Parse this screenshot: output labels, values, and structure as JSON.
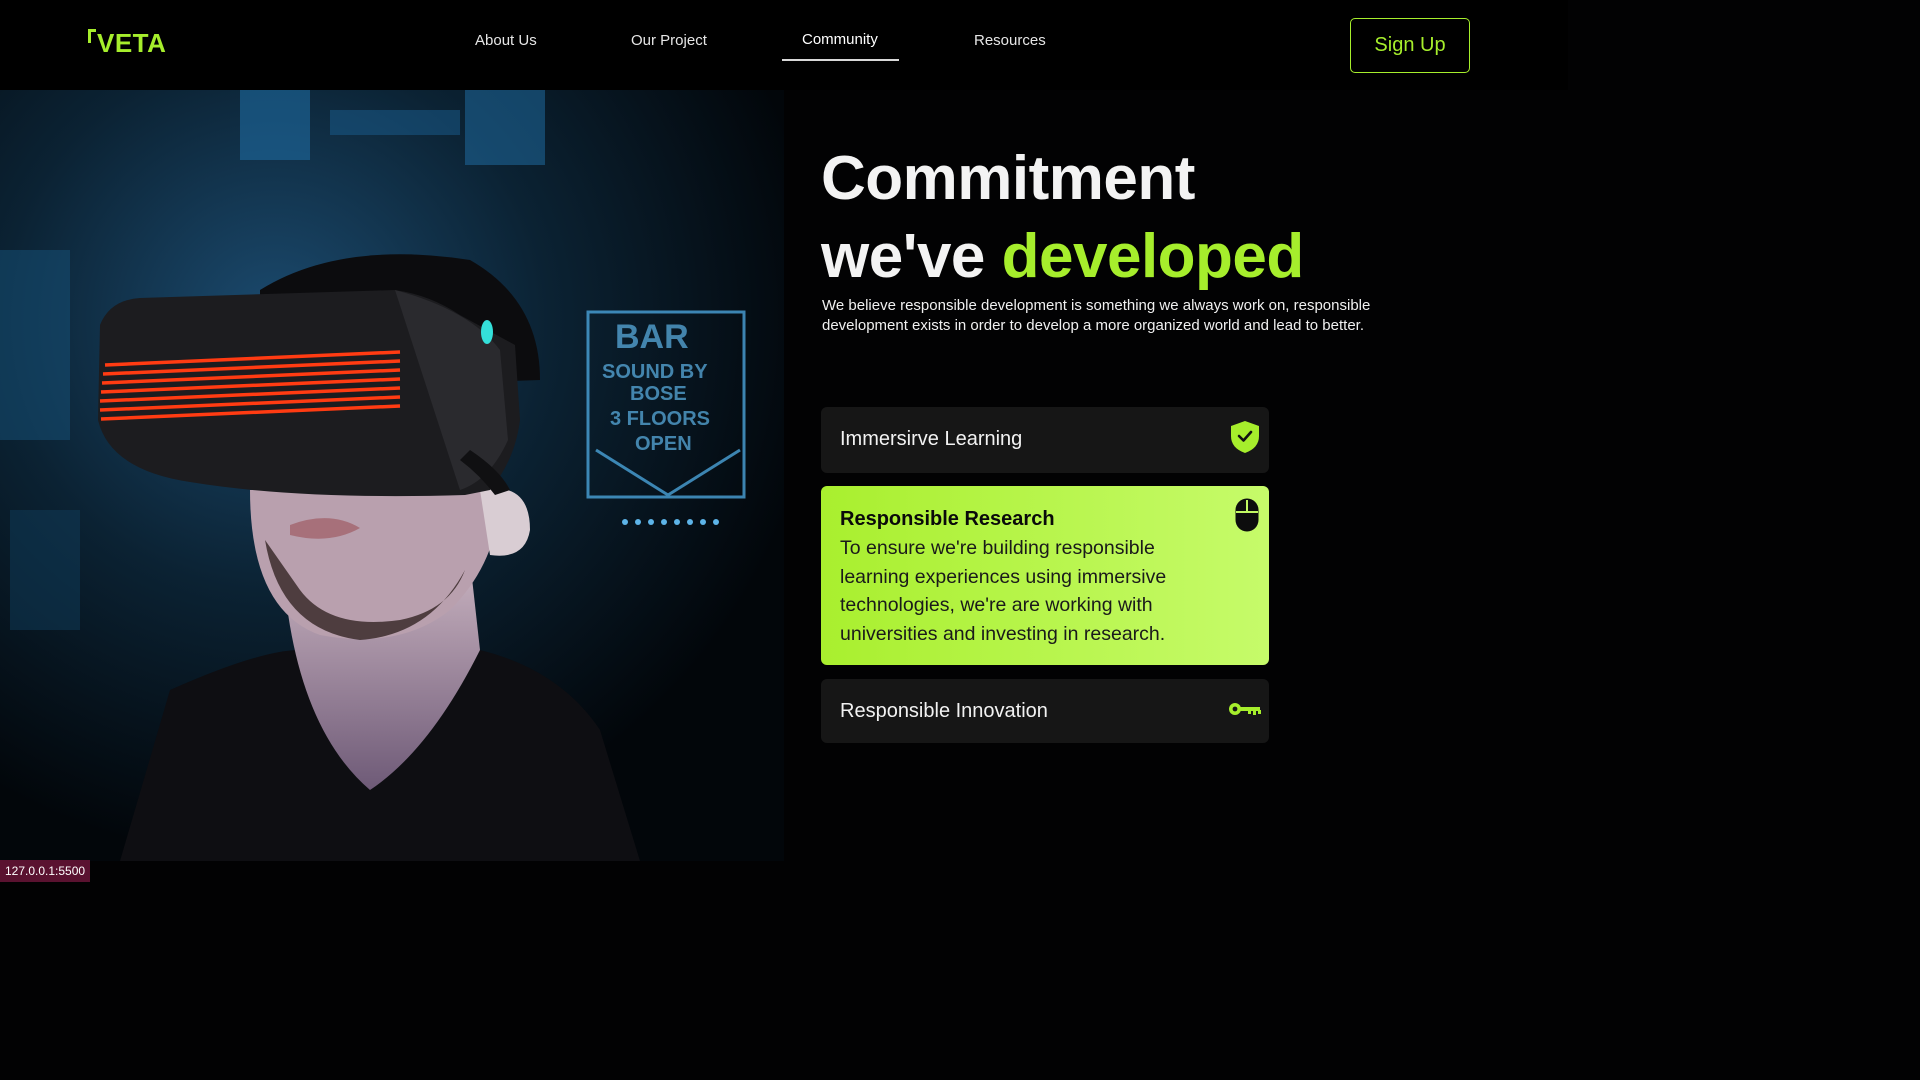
{
  "brand": {
    "name": "VETA",
    "accent": "#a6ee2c"
  },
  "nav": {
    "links": [
      {
        "label": "About Us"
      },
      {
        "label": "Our Project"
      },
      {
        "label": "Community",
        "active": true
      },
      {
        "label": "Resources"
      }
    ],
    "signup_label": "Sign Up"
  },
  "hero": {
    "image_icon": "vr-headset-person-photo"
  },
  "headline": {
    "line1": "Commitment",
    "line2_plain": "we've ",
    "line2_accent": "developed"
  },
  "subtext": "We believe responsible development is something we always work on, responsible development exists in order to develop a more organized world and lead to better.",
  "cards": [
    {
      "title": "Immersirve Learning",
      "icon": "shield-check-icon"
    },
    {
      "title": "Responsible Research",
      "description": "To ensure we're building responsible learning experiences using immersive technologies, we're are working with universities and investing in research.",
      "icon": "mouse-icon",
      "active": true
    },
    {
      "title": "Responsible Innovation",
      "icon": "key-icon"
    }
  ],
  "status_bar": {
    "url": "127.0.0.1:5500"
  }
}
